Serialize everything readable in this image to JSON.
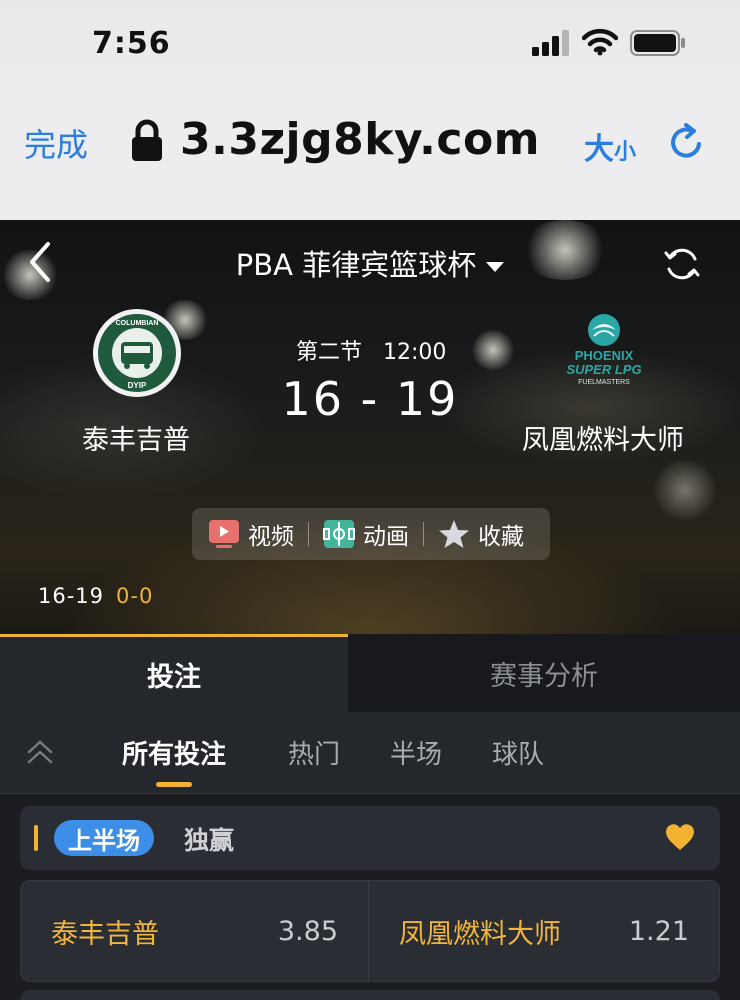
{
  "status_bar": {
    "time": "7:56"
  },
  "browser": {
    "done_label": "完成",
    "url": "3.3zjg8ky.com",
    "text_size_big": "大",
    "text_size_small": "小"
  },
  "match": {
    "league": "PBA 菲律宾篮球杯",
    "period": "第二节",
    "clock": "12:00",
    "score": "16 - 19",
    "home_team": "泰丰吉普",
    "away_team": "凤凰燃料大师",
    "home_logo_text": [
      "COLUMBIAN",
      "DYIP"
    ],
    "away_logo_text": [
      "PHOENIX",
      "SUPER LPG",
      "FUELMASTERS"
    ],
    "half_score_1": "16-19",
    "half_score_2": "0-0"
  },
  "actions": {
    "video": "视频",
    "animation": "动画",
    "favorite": "收藏"
  },
  "main_tabs": [
    {
      "label": "投注"
    },
    {
      "label": "赛事分析"
    }
  ],
  "sub_tabs": [
    {
      "label": "所有投注"
    },
    {
      "label": "热门"
    },
    {
      "label": "半场"
    },
    {
      "label": "球队"
    }
  ],
  "market": {
    "period_pill": "上半场",
    "title": "独赢",
    "selections": [
      {
        "team": "泰丰吉普",
        "odds": "3.85"
      },
      {
        "team": "凤凰燃料大师",
        "odds": "1.21"
      }
    ]
  },
  "colors": {
    "accent": "#f3b232",
    "link_blue": "#2b7de0",
    "pill_blue": "#3d8ee6"
  }
}
